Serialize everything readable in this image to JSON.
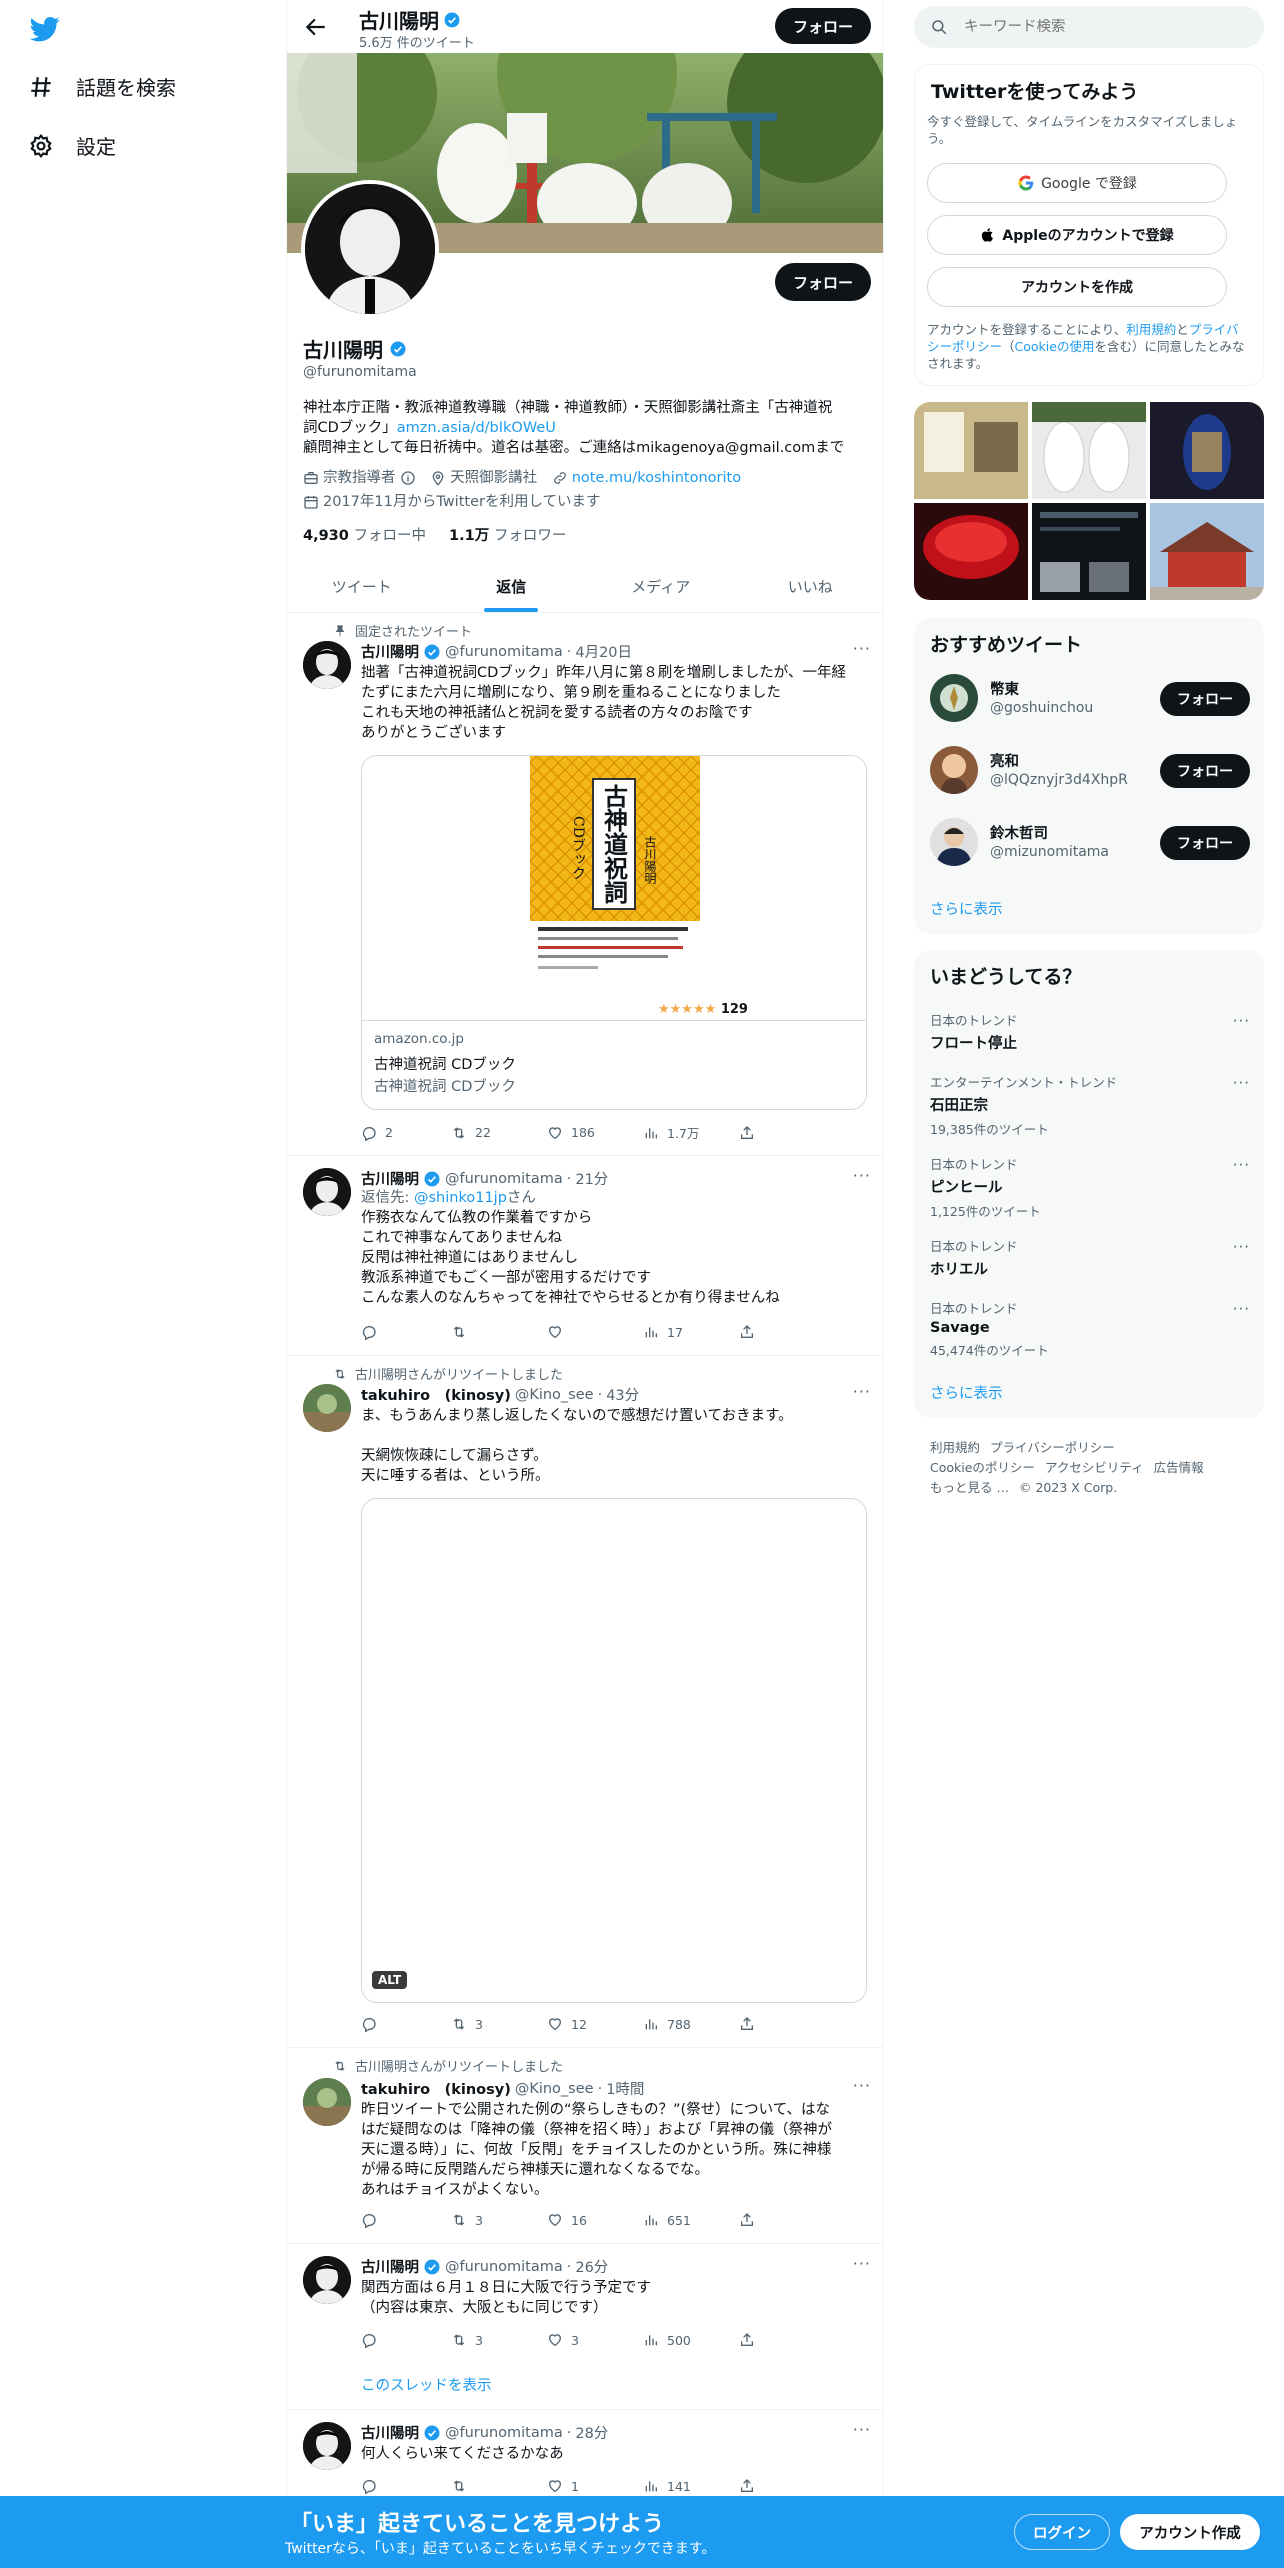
{
  "nav": {
    "explore_label": "話題を検索",
    "settings_label": "設定"
  },
  "topbar": {
    "name": "古川陽明",
    "tweet_count": "5.6万 件のツイート",
    "follow_label": "フォロー"
  },
  "profile": {
    "name": "古川陽明",
    "handle": "@furunomitama",
    "follow_label": "フォロー",
    "bio_line1": "神社本庁正階・教派神道教導職（神職・神道教師）・天照御影講社斎主「古神道祝",
    "bio_line2_prefix": "詞CDブック」",
    "bio_link": "amzn.asia/d/bIkOWeU",
    "bio_line3": "顧問神主として毎日祈祷中。道名は基密。ご連絡はmikagenoya@gmail.comまで",
    "category": "宗教指導者",
    "location": "天照御影講社",
    "website": "note.mu/koshintonorito",
    "joined": "2017年11月からTwitterを利用しています",
    "following_count": "4,930",
    "following_label": "フォロー中",
    "followers_count": "1.1万",
    "followers_label": "フォロワー"
  },
  "tabs": [
    "ツイート",
    "返信",
    "メディア",
    "いいね"
  ],
  "active_tab": "返信",
  "tweets": [
    {
      "context": "固定されたツイート",
      "name": "古川陽明",
      "handle": "@furunomitama",
      "time": "4月20日",
      "text1": "拙著「古神道祝詞CDブック」昨年八月に第８刷を増刷しましたが、一年経",
      "text2": "たずにまた六月に増刷になり、第９刷を重ねることになりました",
      "text3": "これも天地の神祇諸仏と祝詞を愛する読者の方々のお陰です",
      "text4": "ありがとうございます",
      "card_domain": "amazon.co.jp",
      "card_title": "古神道祝詞 CDブック",
      "card_desc": "古神道祝詞 CDブック",
      "book_title": "古神道祝詞",
      "book_sub": "CDブック",
      "book_author": "古川陽明",
      "book_rating": "129",
      "replies": "2",
      "retweets": "22",
      "likes": "186",
      "views": "1.7万"
    },
    {
      "name": "古川陽明",
      "handle": "@furunomitama",
      "time": "21分",
      "reply_prefix": "返信先: ",
      "reply_to": "@shinko11jp",
      "reply_suffix": "さん",
      "text1": "作務衣なんて仏教の作業着ですから",
      "text2": "これで神事なんてありませんね",
      "text3": "反閇は神社神道にはありませんし",
      "text4": "教派系神道でもごく一部が密用するだけです",
      "text5": "こんな素人のなんちゃってを神社でやらせるとか有り得ませんね",
      "replies": "",
      "retweets": "",
      "likes": "",
      "views": "17"
    },
    {
      "context": "古川陽明さんがリツイートしました",
      "name": "takuhiro　(kinosy)",
      "handle": "@Kino_see",
      "time": "43分",
      "text1": "ま、もうあんまり蒸し返したくないので感想だけ置いておきます。",
      "text2": "天網恢恢疎にして漏らさず。",
      "text3": "天に唾する者は、という所。",
      "alt": "ALT",
      "replies": "",
      "retweets": "3",
      "likes": "12",
      "views": "788"
    },
    {
      "context": "古川陽明さんがリツイートしました",
      "name": "takuhiro　(kinosy)",
      "handle": "@Kino_see",
      "time": "1時間",
      "text1": "昨日ツイートで公開された例の“祭らしきもの？”(祭せ）について、はな",
      "text2": "はだ疑問なのは「降神の儀（祭神を招く時）」および「昇神の儀（祭神が",
      "text3": "天に還る時）」に、何故「反閇」をチョイスしたのかという所。殊に神様",
      "text4": "が帰る時に反閇踏んだら神様天に還れなくなるでな。",
      "text5": "あれはチョイスがよくない。",
      "replies": "",
      "retweets": "3",
      "likes": "16",
      "views": "651"
    },
    {
      "name": "古川陽明",
      "handle": "@furunomitama",
      "time": "26分",
      "text1": "関西方面は６月１８日に大阪で行う予定です",
      "text2": "（内容は東京、大阪ともに同じです）",
      "thread_link": "このスレッドを表示",
      "replies": "",
      "retweets": "3",
      "likes": "3",
      "views": "500"
    },
    {
      "name": "古川陽明",
      "handle": "@furunomitama",
      "time": "28分",
      "text1": "何人くらい来てくださるかなあ",
      "replies": "",
      "retweets": "",
      "likes": "1",
      "views": "141"
    }
  ],
  "right": {
    "search_placeholder": "キーワード検索",
    "signup_title": "Twitterを使ってみよう",
    "signup_sub": "今すぐ登録して、タイムラインをカスタマイズしましょう。",
    "google_label": "Google で登録",
    "apple_label": "Appleのアカウントで登録",
    "create_label": "アカウントを作成",
    "terms_1": "アカウントを登録することにより、",
    "terms_link1": "利用規約",
    "terms_2": "と",
    "terms_link2": "プライバシーポリシー",
    "terms_3": "（",
    "terms_link3": "Cookieの使用",
    "terms_4": "を含む）に同意したとみなされます。",
    "rec_title": "おすすめツイート",
    "recs": [
      {
        "name": "幣東",
        "handle": "@goshuinchou",
        "follow": "フォロー"
      },
      {
        "name": "亮和",
        "handle": "@lQQznyjr3d4XhpR",
        "follow": "フォロー"
      },
      {
        "name": "鈴木哲司",
        "handle": "@mizunomitama",
        "follow": "フォロー"
      }
    ],
    "show_more": "さらに表示",
    "trends_title": "いまどうしてる？",
    "trends": [
      {
        "cat": "日本のトレンド",
        "title": "フロート停止",
        "count": ""
      },
      {
        "cat": "エンターテインメント・トレンド",
        "title": "石田正宗",
        "count": "19,385件のツイート"
      },
      {
        "cat": "日本のトレンド",
        "title": "ピンヒール",
        "count": "1,125件のツイート"
      },
      {
        "cat": "日本のトレンド",
        "title": "ホリエル",
        "count": ""
      },
      {
        "cat": "日本のトレンド",
        "title": "Savage",
        "count": "45,474件のツイート"
      }
    ],
    "trends_more": "さらに表示",
    "footer": [
      "利用規約",
      "プライバシーポリシー",
      "Cookieのポリシー",
      "アクセシビリティ",
      "広告情報",
      "もっと見る …",
      "© 2023 X Corp."
    ]
  },
  "bottom": {
    "title": "「いま」起きていることを見つけよう",
    "sub": "Twitterなら、「いま」起きていることをいち早くチェックできます。",
    "login": "ログイン",
    "signup": "アカウント作成"
  },
  "colors": {
    "accent": "#1d9bf0",
    "text": "#0f1419",
    "secondary": "#536471"
  }
}
